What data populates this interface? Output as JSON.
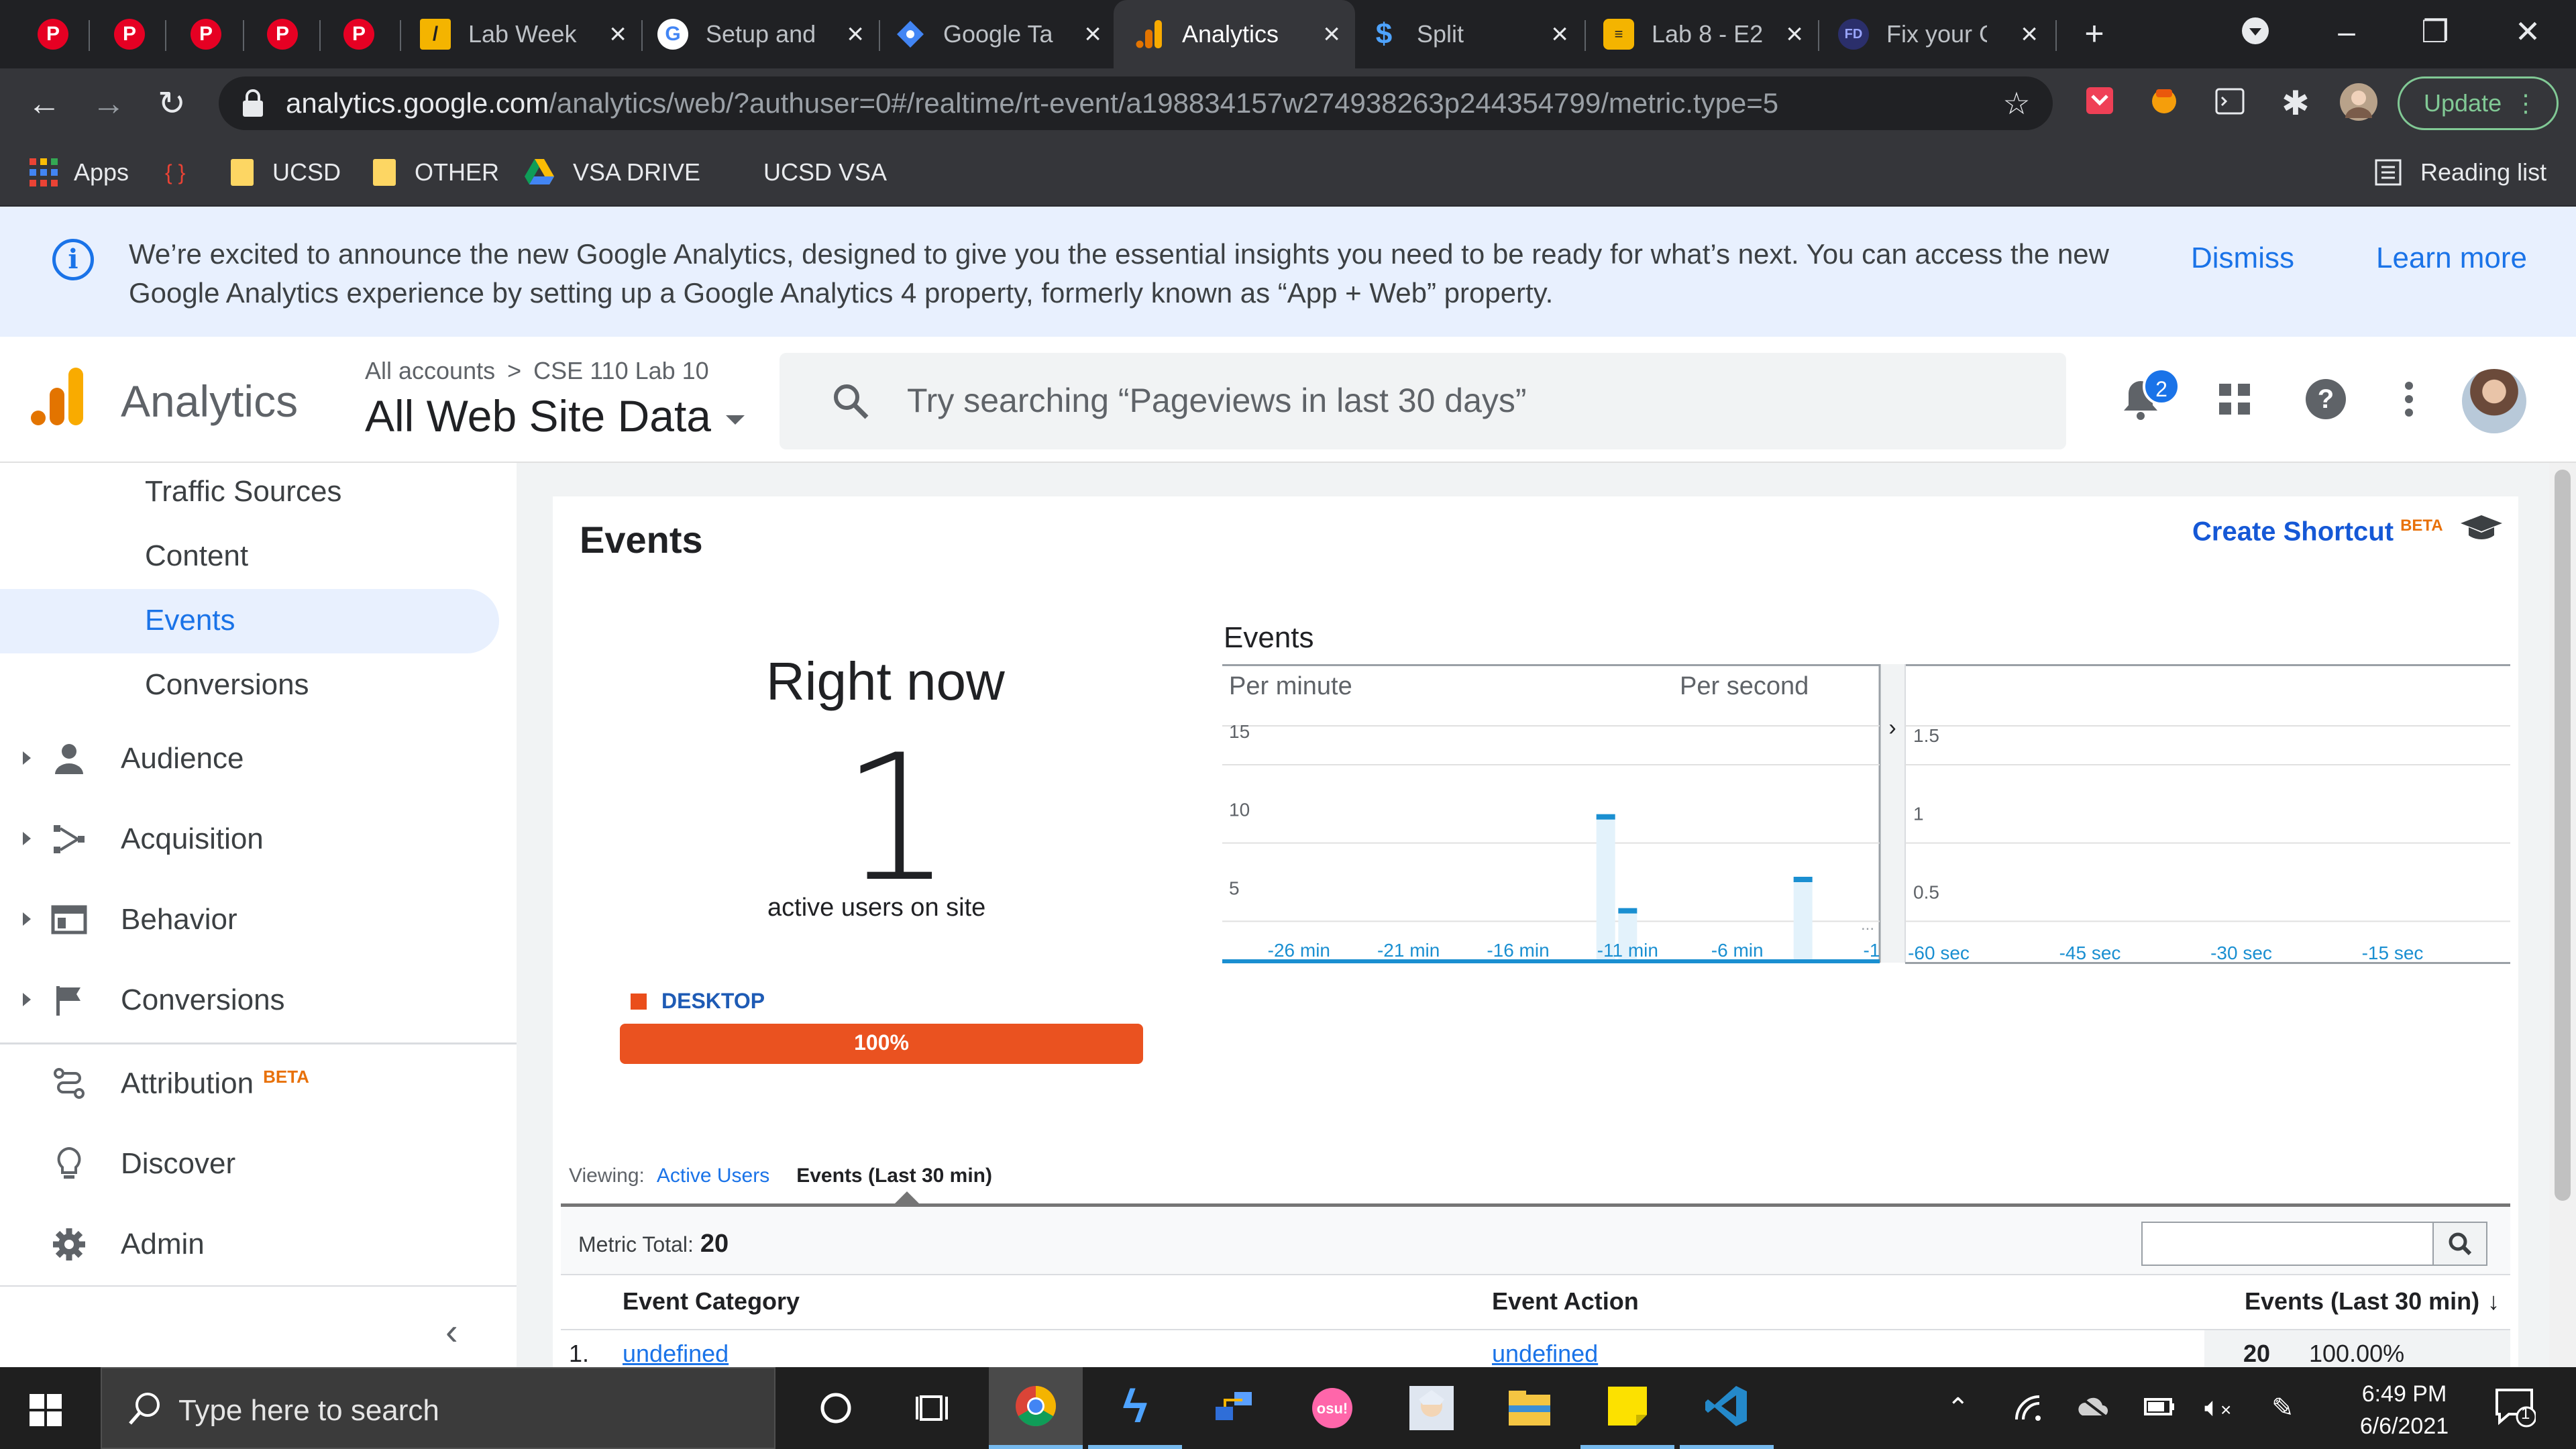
{
  "browser": {
    "tabs": [
      {
        "title": "",
        "icon": "pinterest-icon"
      },
      {
        "title": "",
        "icon": "pinterest-icon"
      },
      {
        "title": "",
        "icon": "pinterest-icon"
      },
      {
        "title": "",
        "icon": "pinterest-icon"
      },
      {
        "title": "",
        "icon": "pinterest-icon"
      },
      {
        "title": "Lab Week",
        "icon": "lab-icon"
      },
      {
        "title": "Setup and",
        "icon": "google-icon"
      },
      {
        "title": "Google Ta",
        "icon": "tag-manager-icon"
      },
      {
        "title": "Analytics",
        "icon": "analytics-icon",
        "active": true
      },
      {
        "title": "Split",
        "icon": "split-icon"
      },
      {
        "title": "Lab 8 - E2",
        "icon": "lab-icon"
      },
      {
        "title": "Fix your G",
        "icon": "fd-icon"
      }
    ],
    "url_host": "analytics.google.com",
    "url_path": "/analytics/web/?authuser=0#/realtime/rt-event/a198834157w274938263p244354799/metric.type=5",
    "update_label": "Update",
    "bookmarks": {
      "apps": "Apps",
      "items": [
        "UCSD",
        "OTHER",
        "VSA DRIVE",
        "UCSD VSA"
      ],
      "reading_list": "Reading list"
    }
  },
  "banner": {
    "text": "We’re excited to announce the new Google Analytics, designed to give you the essential insights you need to be ready for what’s next. You can access the new Google Analytics experience by setting up a Google Analytics 4 property, formerly known as “App + Web” property.",
    "dismiss": "Dismiss",
    "learn_more": "Learn more"
  },
  "header": {
    "product": "Analytics",
    "crumb_accounts": "All accounts",
    "crumb_sep": ">",
    "crumb_property": "CSE 110 Lab 10",
    "view": "All Web Site Data",
    "search_placeholder": "Try searching “Pageviews in last 30 days”",
    "notifications": "2"
  },
  "sidebar": {
    "sub_items": [
      "Traffic Sources",
      "Content",
      "Events",
      "Conversions"
    ],
    "nav": {
      "audience": "Audience",
      "acquisition": "Acquisition",
      "behavior": "Behavior",
      "conversions": "Conversions",
      "attribution": "Attribution",
      "attribution_beta": "BETA",
      "discover": "Discover",
      "admin": "Admin"
    }
  },
  "report": {
    "title": "Events",
    "create_shortcut": "Create Shortcut",
    "shortcut_beta": "BETA",
    "right_now": "Right now",
    "active_users": "1",
    "active_users_label": "active users on site",
    "device_label": "DESKTOP",
    "device_pct_label": "100%",
    "device_fraction": 1.0,
    "viewing_label": "Viewing:",
    "viewing_link": "Active Users",
    "viewing_current": "Events (Last 30 min)",
    "metric_total_label": "Metric Total:",
    "metric_total": "20",
    "columns": [
      "Event Category",
      "Event Action",
      "Events (Last 30 min)"
    ],
    "rows": [
      {
        "num": "1.",
        "category": "undefined",
        "action": "undefined",
        "events": "20",
        "pct": "100.00%"
      }
    ]
  },
  "chart_data": {
    "type": "bar",
    "title": "Events",
    "panels": [
      {
        "name": "Per minute",
        "x_tick_labels": [
          "-26 min",
          "-21 min",
          "-16 min",
          "-11 min",
          "-6 min",
          "-1"
        ],
        "y_ticks": [
          5,
          10,
          15
        ],
        "ylim": [
          0,
          15
        ],
        "bars": [
          {
            "minutes_ago": 12,
            "value": 10
          },
          {
            "minutes_ago": 11,
            "value": 4
          },
          {
            "minutes_ago": 3,
            "value": 6
          }
        ]
      },
      {
        "name": "Per second",
        "x_tick_labels": [
          "-60 sec",
          "-45 sec",
          "-30 sec",
          "-15 sec"
        ],
        "y_ticks": [
          0.5,
          1,
          1.5
        ],
        "ylim": [
          0,
          1.5
        ],
        "bars": []
      }
    ],
    "accent_color": "#1a8fd1"
  },
  "taskbar": {
    "search_placeholder": "Type here to search",
    "time": "6:49 PM",
    "date": "6/6/2021",
    "notifications": "1"
  }
}
